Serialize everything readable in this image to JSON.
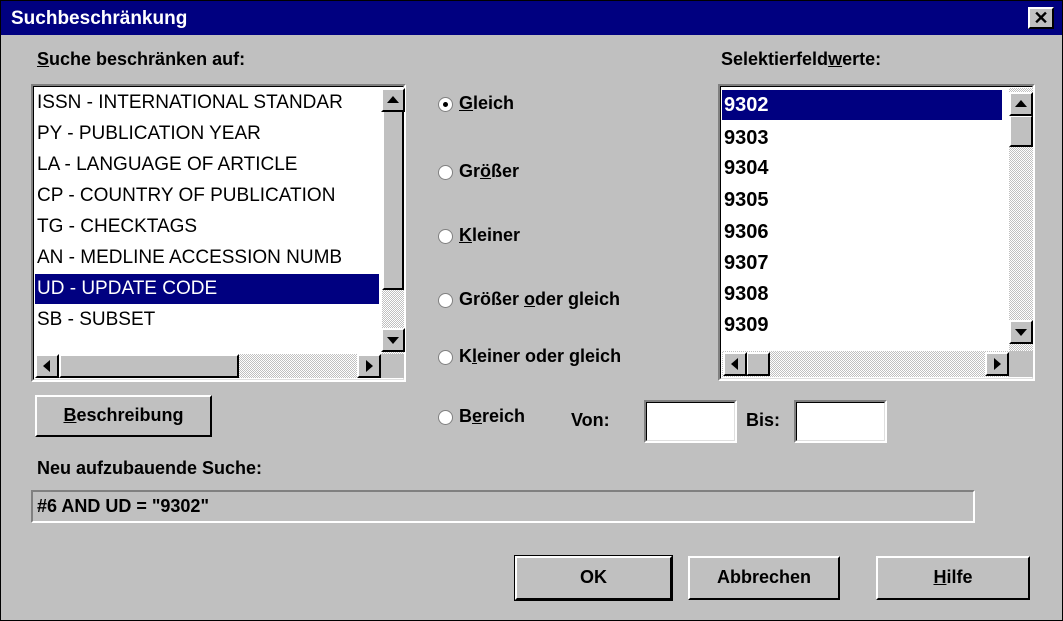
{
  "window": {
    "title": "Suchbeschränkung",
    "close_glyph": "✕"
  },
  "left": {
    "label_u": "S",
    "label_rest": "uche beschränken auf:",
    "items": [
      "ISSN - INTERNATIONAL STANDAR",
      "PY - PUBLICATION YEAR",
      "LA - LANGUAGE OF ARTICLE",
      "CP - COUNTRY OF PUBLICATION",
      "TG - CHECKTAGS",
      "AN - MEDLINE ACCESSION NUMB",
      "UD - UPDATE CODE",
      "SB - SUBSET"
    ],
    "selected_index": 6
  },
  "options": {
    "gleich": {
      "u": "G",
      "rest": "leich",
      "checked": true
    },
    "groesser": {
      "pre": "Gr",
      "u": "ö",
      "post": "ßer"
    },
    "kleiner": {
      "u": "K",
      "rest": "leiner"
    },
    "groesser_gleich": {
      "pre": "Größer ",
      "u": "o",
      "post": "der gleich"
    },
    "kleiner_gleich": {
      "pre": "K",
      "u": "l",
      "post": "einer oder gleich"
    },
    "bereich": {
      "pre": "B",
      "u": "e",
      "post": "reich"
    },
    "von_label": "Von:",
    "bis_label": "Bis:",
    "von_value": "",
    "bis_value": ""
  },
  "right": {
    "label_pre": "Selektierfeld",
    "label_u": "w",
    "label_post": "erte:",
    "values": [
      "9302",
      "9303",
      "9304",
      "9305",
      "9306",
      "9307",
      "9308",
      "9309"
    ],
    "selected_index": 0
  },
  "describe_button": {
    "u": "B",
    "rest": "eschreibung"
  },
  "query": {
    "label": "Neu aufzubauende Suche:",
    "value": "#6 AND UD = \"9302\""
  },
  "buttons": {
    "ok": "OK",
    "cancel": "Abbrechen",
    "help_u": "H",
    "help_rest": "ilfe"
  }
}
